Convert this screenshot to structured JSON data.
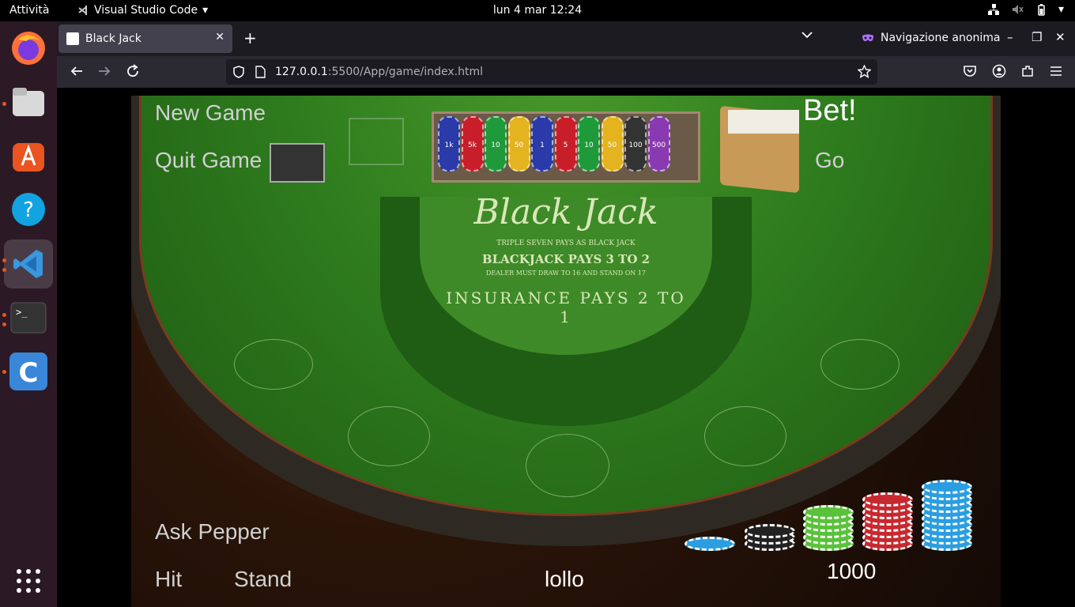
{
  "os": {
    "activities": "Attività",
    "app_menu": "Visual Studio Code",
    "clock": "lun 4 mar  12:24"
  },
  "dock": {
    "items": [
      {
        "name": "firefox-icon",
        "color": "#ff7139"
      },
      {
        "name": "files-icon",
        "color": "#d9d9d9"
      },
      {
        "name": "app-center-icon",
        "color": "#e95420"
      },
      {
        "name": "help-icon",
        "color": "#12a3e0"
      },
      {
        "name": "vscode-icon",
        "color": "#3a96dd"
      },
      {
        "name": "terminal-icon",
        "color": "#333333"
      },
      {
        "name": "c-app-icon",
        "color": "#3a86d8"
      },
      {
        "name": "app-grid-icon",
        "color": "#ffffff"
      }
    ]
  },
  "browser": {
    "tab_title": "Black Jack",
    "private_label": "Navigazione anonima",
    "url_host": "127.0.0.1",
    "url_path": ":5500/App/game/index.html"
  },
  "game": {
    "new_game": "New Game",
    "quit_game": "Quit Game",
    "bet": "Bet!",
    "go": "Go",
    "ask_pepper": "Ask Pepper",
    "hit": "Hit",
    "stand": "Stand",
    "player_name": "lollo",
    "balance": "1000",
    "table": {
      "title": "Black Jack",
      "line1": "TRIPLE SEVEN PAYS AS BLACK JACK",
      "line2": "BLACKJACK PAYS 3 TO 2",
      "line3": "DEALER MUST DRAW TO 16 AND STAND ON 17",
      "line4": "INSURANCE PAYS 2 TO 1"
    },
    "tray_chips": [
      {
        "label": "1k",
        "color": "#2a3aa8"
      },
      {
        "label": "5k",
        "color": "#c81e2a"
      },
      {
        "label": "10",
        "color": "#1f9a3a"
      },
      {
        "label": "50",
        "color": "#e3b320"
      },
      {
        "label": "1",
        "color": "#2a3aa8"
      },
      {
        "label": "5",
        "color": "#c81e2a"
      },
      {
        "label": "10",
        "color": "#1f9a3a"
      },
      {
        "label": "50",
        "color": "#e3b320"
      },
      {
        "label": "100",
        "color": "#333333"
      },
      {
        "label": "500",
        "color": "#8a3ab0"
      }
    ],
    "chip_stacks": [
      {
        "name": "blue-chip-single",
        "color": "#2a9ee0",
        "count": 1
      },
      {
        "name": "black-chip-stack",
        "color": "#222222",
        "count": 3
      },
      {
        "name": "green-chip-stack",
        "color": "#5ac23a",
        "count": 6
      },
      {
        "name": "red-chip-stack",
        "color": "#c8282f",
        "count": 8
      },
      {
        "name": "blue-chip-stack",
        "color": "#2a9ee0",
        "count": 10
      }
    ]
  }
}
